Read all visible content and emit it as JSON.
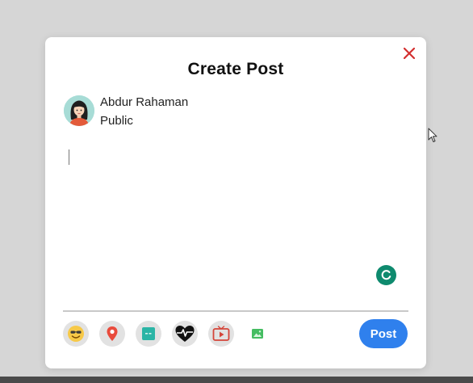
{
  "modal": {
    "title": "Create Post",
    "close_icon": "close-icon",
    "close_color": "#d32f2f"
  },
  "user": {
    "name": "Abdur Rahaman",
    "privacy": "Public",
    "avatar_bg": "#a7dcd6"
  },
  "composer": {
    "value": "",
    "placeholder": ""
  },
  "toolbar": {
    "tools": [
      {
        "icon": "smiley-icon",
        "name": "feeling"
      },
      {
        "icon": "location-pin-icon",
        "name": "location"
      },
      {
        "icon": "gif-icon",
        "name": "gif"
      },
      {
        "icon": "heartbeat-icon",
        "name": "life-event"
      },
      {
        "icon": "video-play-icon",
        "name": "video"
      },
      {
        "icon": "image-icon",
        "name": "photo"
      }
    ],
    "post_label": "Post"
  },
  "colors": {
    "accent": "#2f80ed",
    "page_background": "#d6d6d6"
  }
}
